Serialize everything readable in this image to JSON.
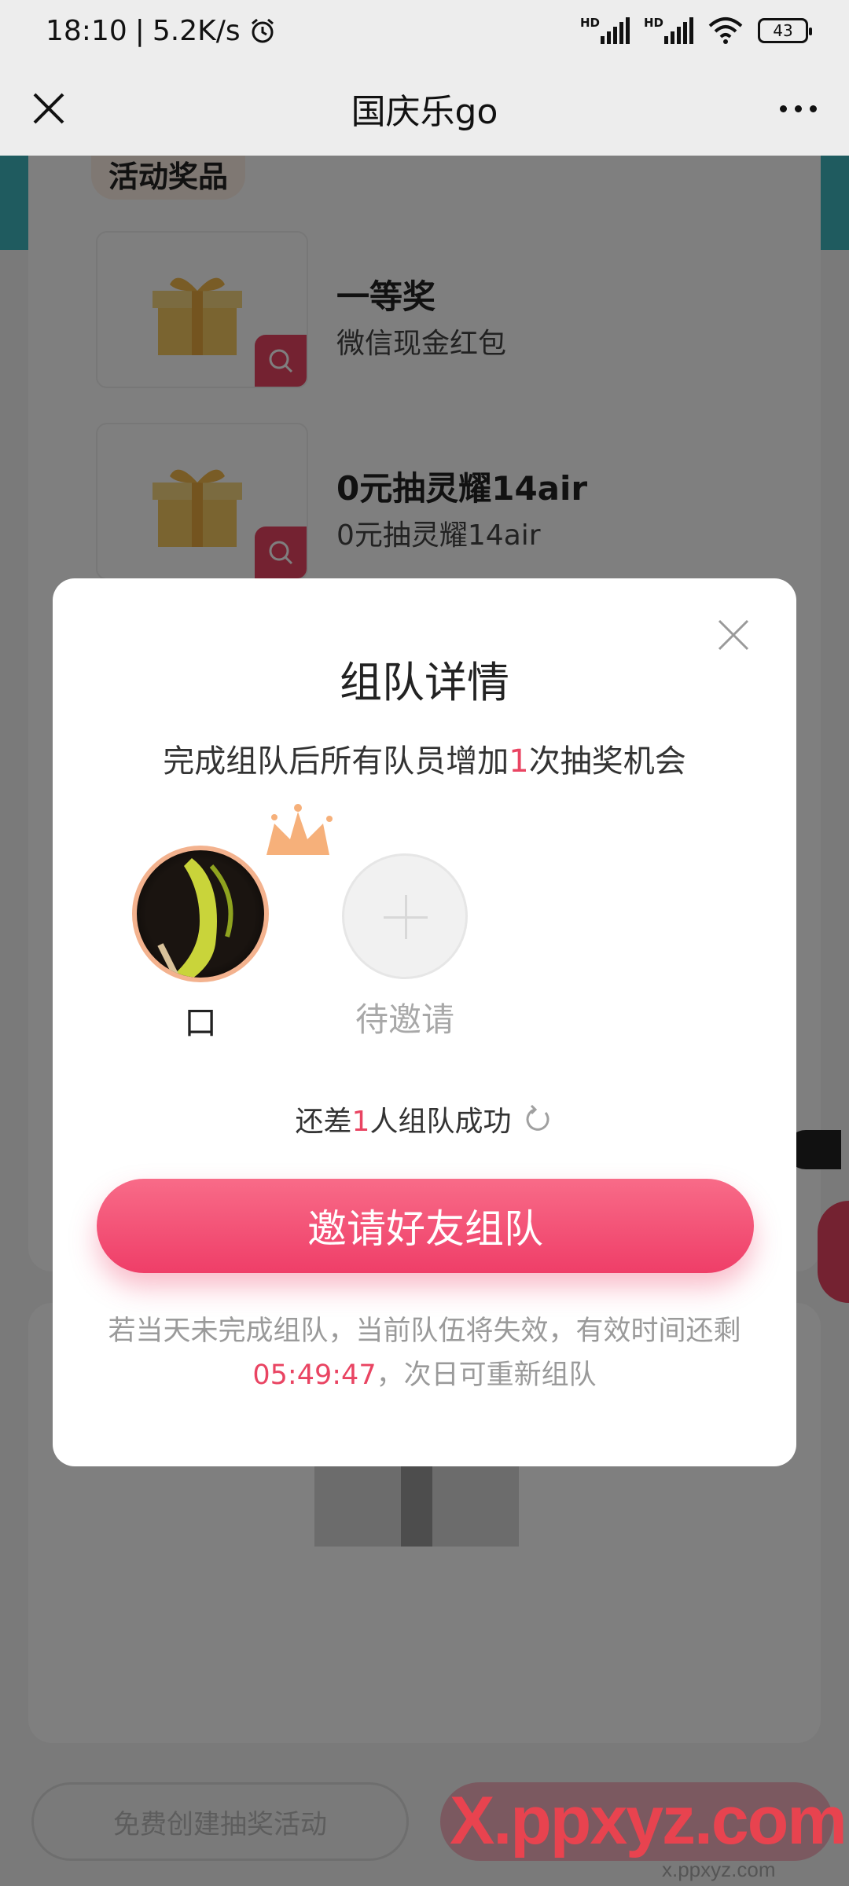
{
  "status_bar": {
    "time": "18:10",
    "network_speed": "5.2K/s",
    "hd_label": "HD",
    "battery": "43",
    "icons": [
      "alarm-icon",
      "signal-icon",
      "signal-icon",
      "wifi-icon",
      "battery-icon"
    ]
  },
  "nav": {
    "title": "国庆乐go",
    "close_icon": "close-icon",
    "more_icon": "more-icon"
  },
  "background": {
    "section_title": "活动奖品",
    "prizes": [
      {
        "name": "一等奖",
        "desc": "微信现金红包"
      },
      {
        "name": "0元抽灵耀14air",
        "desc": "0元抽灵耀14air"
      }
    ],
    "bottom_left_button": "免费创建抽奖活动"
  },
  "modal": {
    "title": "组队详情",
    "subtitle_prefix": "完成组队后所有队员增加",
    "subtitle_count": "1",
    "subtitle_suffix": "次抽奖机会",
    "members": [
      {
        "name": "口",
        "role": "leader"
      },
      {
        "name": "待邀请",
        "role": "pending"
      }
    ],
    "status_prefix": "还差",
    "status_count": "1",
    "status_suffix": "人组队成功",
    "invite_button": "邀请好友组队",
    "notice_prefix": "若当天未完成组队，当前队伍将失效，有效时间还剩",
    "notice_timer": "05:49:47",
    "notice_suffix": "，次日可重新组队"
  },
  "watermark": {
    "logo": "X.ppxyz.com",
    "sub": "x.ppxyz.com"
  },
  "colors": {
    "accent": "#ef3e68",
    "teal": "#3fb7bf",
    "nav_bg": "#ededed"
  }
}
